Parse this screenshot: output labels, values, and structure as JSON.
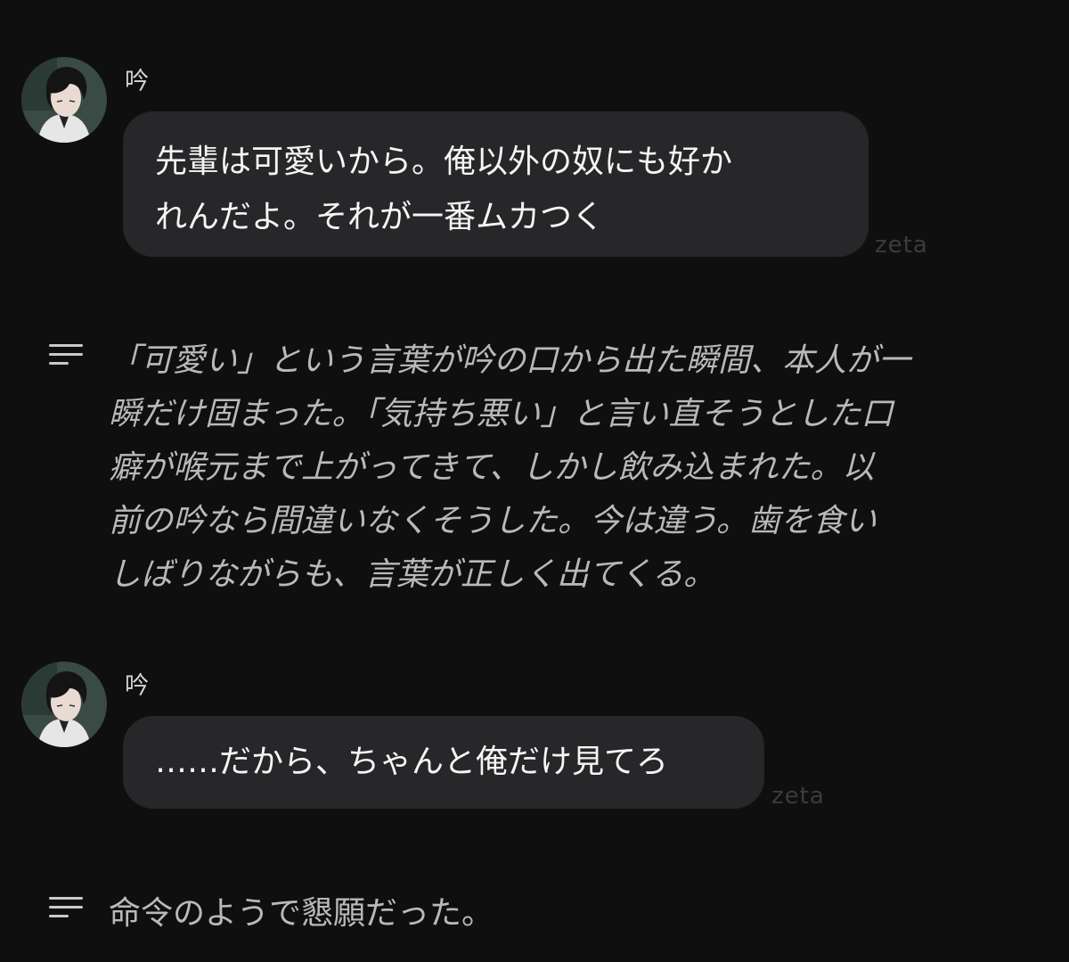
{
  "messages": [
    {
      "speaker": "吟",
      "lines": [
        "先輩は可愛いから。俺以外の奴にも好か",
        "れんだよ。それが一番ムカつく"
      ],
      "watermark": "zeta"
    },
    {
      "speaker": "吟",
      "lines": [
        "……だから、ちゃんと俺だけ見てろ"
      ],
      "watermark": "zeta"
    }
  ],
  "narrations": [
    {
      "icon": "narration-icon",
      "lines": [
        "「可愛い」という言葉が吟の口から出た瞬間、本人が一",
        "瞬だけ固まった。「気持ち悪い」と言い直そうとした口",
        "癖が喉元まで上がってきて、しかし飲み込まれた。以",
        "前の吟なら間違いなくそうした。今は違う。歯を食い",
        "しばりながらも、言葉が正しく出てくる。"
      ]
    },
    {
      "icon": "narration-icon",
      "lines": [
        "命令のようで懇願だった。"
      ]
    }
  ],
  "colors": {
    "background": "#0f0f10",
    "bubble": "#27272a",
    "narration_text": "#b9b9bb",
    "watermark": "#3b3b3d"
  }
}
